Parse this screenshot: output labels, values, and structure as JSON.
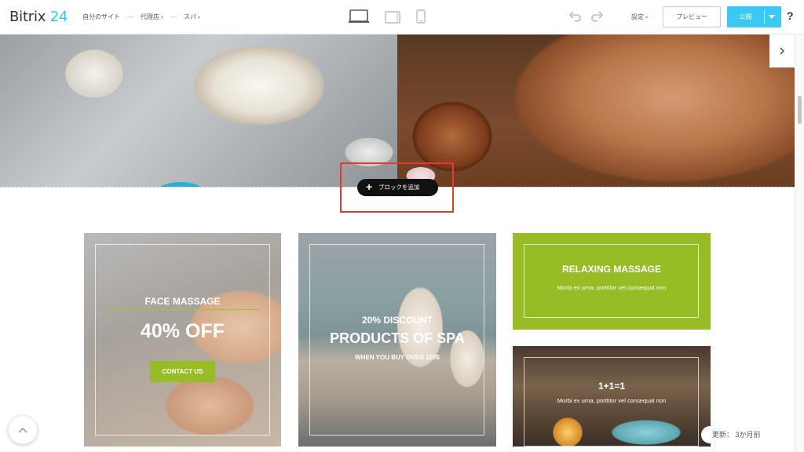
{
  "app": {
    "logo_text": "Bitrix",
    "logo_num": "24"
  },
  "breadcrumbs": [
    {
      "label": "自分のサイト"
    },
    {
      "label": "代理店"
    },
    {
      "label": "スパ"
    }
  ],
  "toolbar": {
    "settings_label": "設定",
    "preview_label": "プレビュー",
    "publish_label": "公開",
    "help_label": "?"
  },
  "editor": {
    "add_block_label": "ブロックを追加",
    "updated_label": "更新： 3か月前"
  },
  "cards": {
    "face": {
      "title": "FACE MASSAGE",
      "offer": "40% OFF",
      "button": "CONTACT US"
    },
    "spa": {
      "line1": "20% DISCOUNT",
      "line2": "PRODUCTS OF SPA",
      "line3": "WHEN YOU BUY OVER 100$"
    },
    "relax": {
      "title": "RELAXING MASSAGE",
      "subtitle": "Morbi ex urna, porttitor vel consequat non"
    },
    "oneplus": {
      "title": "1+1=1",
      "subtitle": "Morbi ex urna, porttitor vel consequat non"
    }
  },
  "icons": [
    "desktop-icon",
    "tablet-icon",
    "mobile-icon",
    "undo-icon",
    "redo-icon",
    "chevron-right-icon",
    "plus-icon",
    "chevron-up-icon"
  ],
  "colors": {
    "accent_blue": "#3bc8f5",
    "brand_green": "#97bc26",
    "highlight_red": "#e8372d"
  }
}
